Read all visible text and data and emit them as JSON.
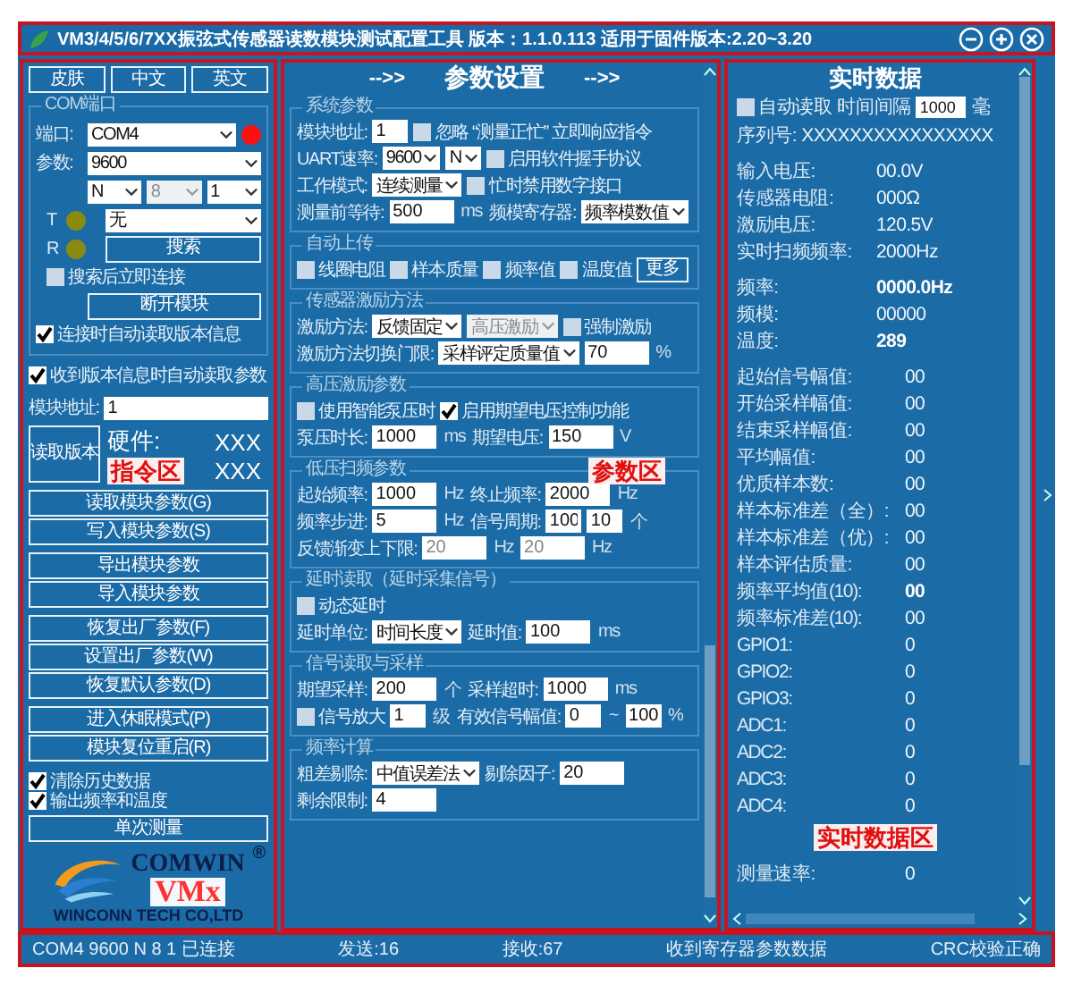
{
  "window": {
    "title": "VM3/4/5/6/7XX振弦式传感器读数模块测试配置工具   版本：1.1.0.113 适用于固件版本:2.20~3.20"
  },
  "left_panel": {
    "annotation": "指令区",
    "top_buttons": [
      "皮肤",
      "中文",
      "英文"
    ],
    "com_group": {
      "title": "COM端口",
      "port_label": "端口:",
      "port": "COM4",
      "port_lamp": {
        "on": true
      },
      "params_label": "参数:",
      "baud": "9600",
      "parity": "N",
      "data_bits": {
        "value": "8",
        "disabled": true
      },
      "stop_bits": "1",
      "flow": "无",
      "lamps": [
        {
          "label": "T",
          "on": false
        },
        {
          "label": "R",
          "on": false
        }
      ],
      "search_button": "搜索",
      "connect_after_search": {
        "label": "搜索后立即连接",
        "checked": false
      },
      "disconnect_button": "断开模块",
      "auto_read_version": {
        "label": "连接时自动读取版本信息",
        "checked": true
      }
    },
    "auto_read_params": {
      "label": "收到版本信息时自动读取参数",
      "checked": true
    },
    "address_label": "模块地址:",
    "address": "1",
    "read_version_button": "读取版本",
    "version_rows": [
      {
        "label": "硬件:",
        "value": "XXX"
      },
      {
        "value": "XXX"
      }
    ],
    "button_groups": [
      [
        "读取模块参数(G)",
        "写入模块参数(S)"
      ],
      [
        "导出模块参数",
        "导入模块参数"
      ],
      [
        "恢复出厂参数(F)",
        "设置出厂参数(W)",
        "恢复默认参数(D)"
      ],
      [
        "进入休眠模式(P)",
        "模块复位重启(R)"
      ]
    ],
    "bottom_checks": [
      {
        "label": "清除历史数据",
        "checked": true
      },
      {
        "label": "输出频率和温度",
        "checked": true
      }
    ],
    "single_measure_button": "单次测量",
    "logo": {
      "brand": "COMWIN",
      "reg": "®",
      "product": "VMx",
      "company": "WINCONN TECH CO,LTD"
    }
  },
  "middle_panel": {
    "annotation": "参数区",
    "header": {
      "left": "-->>",
      "title": "参数设置",
      "right": "-->>"
    },
    "groups": [
      {
        "title": "系统参数",
        "rows": [
          {
            "items": [
              {
                "kind": "label",
                "text": "模块地址:"
              },
              {
                "kind": "short_input",
                "value": "1"
              },
              {
                "kind": "checkbox",
                "text": "忽略 “测量正忙” 立即响应指令",
                "checked": false
              }
            ]
          },
          {
            "items": [
              {
                "kind": "label",
                "text": "UART速率:"
              },
              {
                "kind": "select",
                "value": "9600"
              },
              {
                "kind": "select",
                "value": "N"
              },
              {
                "kind": "checkbox",
                "text": "启用软件握手协议",
                "checked": false
              }
            ]
          },
          {
            "items": [
              {
                "kind": "label",
                "text": "工作模式:"
              },
              {
                "kind": "select",
                "value": "连续测量"
              },
              {
                "kind": "checkbox",
                "text": "忙时禁用数字接口",
                "checked": false
              }
            ]
          },
          {
            "items": [
              {
                "kind": "label",
                "text": "测量前等待:"
              },
              {
                "kind": "input",
                "value": "500"
              },
              {
                "kind": "unit",
                "text": "ms"
              },
              {
                "kind": "label",
                "text": "频模寄存器:"
              },
              {
                "kind": "select",
                "value": "频率模数值"
              }
            ]
          }
        ]
      },
      {
        "title": "自动上传",
        "rows": [
          {
            "items": [
              {
                "kind": "checkbox",
                "text": "线圈电阻",
                "checked": false
              },
              {
                "kind": "checkbox",
                "text": "样本质量",
                "checked": false
              },
              {
                "kind": "checkbox",
                "text": "频率值",
                "checked": false
              },
              {
                "kind": "checkbox",
                "text": "温度值",
                "checked": false
              },
              {
                "kind": "button",
                "text": "更多"
              }
            ]
          }
        ]
      },
      {
        "title": "传感器激励方法",
        "rows": [
          {
            "items": [
              {
                "kind": "label",
                "text": "激励方法:"
              },
              {
                "kind": "select",
                "value": "反馈固定"
              },
              {
                "kind": "select",
                "value": "高压激励",
                "disabled": true
              },
              {
                "kind": "checkbox",
                "text": "强制激励",
                "checked": false
              }
            ]
          },
          {
            "items": [
              {
                "kind": "label",
                "text": "激励方法切换门限:"
              },
              {
                "kind": "select",
                "value": "采样评定质量值"
              },
              {
                "kind": "input",
                "value": "70"
              },
              {
                "kind": "unit",
                "text": "%"
              }
            ]
          }
        ]
      },
      {
        "title": "高压激励参数",
        "rows": [
          {
            "items": [
              {
                "kind": "checkbox",
                "text": "使用智能泵压时",
                "checked": false
              },
              {
                "kind": "checkbox",
                "text": "启用期望电压控制功能",
                "checked": true
              }
            ]
          },
          {
            "items": [
              {
                "kind": "label",
                "text": "泵压时长:"
              },
              {
                "kind": "input",
                "value": "1000"
              },
              {
                "kind": "unit",
                "text": "ms"
              },
              {
                "kind": "label",
                "text": "期望电压:"
              },
              {
                "kind": "input",
                "value": "150"
              },
              {
                "kind": "unit",
                "text": "V"
              }
            ]
          }
        ]
      },
      {
        "title": "低压扫频参数",
        "rows": [
          {
            "items": [
              {
                "kind": "label",
                "text": "起始频率:"
              },
              {
                "kind": "input",
                "value": "1000"
              },
              {
                "kind": "unit",
                "text": "Hz"
              },
              {
                "kind": "label",
                "text": "终止频率:"
              },
              {
                "kind": "input",
                "value": "2000"
              },
              {
                "kind": "unit",
                "text": "Hz"
              }
            ]
          },
          {
            "items": [
              {
                "kind": "label",
                "text": "频率步进:"
              },
              {
                "kind": "input",
                "value": "5"
              },
              {
                "kind": "unit",
                "text": "Hz"
              },
              {
                "kind": "label",
                "text": "信号周期:"
              },
              {
                "kind": "short_input",
                "value": "100"
              },
              {
                "kind": "short_input",
                "value": "10"
              },
              {
                "kind": "unit",
                "text": "个"
              }
            ]
          },
          {
            "items": [
              {
                "kind": "label",
                "text": "反馈渐变上下限:"
              },
              {
                "kind": "input",
                "value": "20",
                "disabled": true
              },
              {
                "kind": "unit",
                "text": "Hz"
              },
              {
                "kind": "input",
                "value": "20",
                "disabled": true
              },
              {
                "kind": "unit",
                "text": "Hz"
              }
            ]
          }
        ]
      },
      {
        "title": "延时读取（延时采集信号）",
        "rows": [
          {
            "items": [
              {
                "kind": "checkbox",
                "text": "动态延时",
                "checked": false
              }
            ]
          },
          {
            "items": [
              {
                "kind": "label",
                "text": "延时单位:"
              },
              {
                "kind": "select",
                "value": "时间长度"
              },
              {
                "kind": "label",
                "text": "延时值:"
              },
              {
                "kind": "input",
                "value": "100"
              },
              {
                "kind": "unit",
                "text": "ms"
              }
            ]
          }
        ]
      },
      {
        "title": "信号读取与采样",
        "rows": [
          {
            "items": [
              {
                "kind": "label",
                "text": "期望采样:"
              },
              {
                "kind": "input",
                "value": "200"
              },
              {
                "kind": "unit",
                "text": "个"
              },
              {
                "kind": "label",
                "text": "采样超时:"
              },
              {
                "kind": "input",
                "value": "1000"
              },
              {
                "kind": "unit",
                "text": "ms"
              }
            ]
          },
          {
            "items": [
              {
                "kind": "checkbox",
                "text": "信号放大",
                "checked": false
              },
              {
                "kind": "short_input",
                "value": "1"
              },
              {
                "kind": "unit",
                "text": "级"
              },
              {
                "kind": "label",
                "text": "有效信号幅值:"
              },
              {
                "kind": "short_input",
                "value": "0"
              },
              {
                "kind": "unit",
                "text": "~"
              },
              {
                "kind": "short_input",
                "value": "100"
              },
              {
                "kind": "unit",
                "text": "%"
              }
            ]
          }
        ]
      },
      {
        "title": "频率计算",
        "rows": [
          {
            "items": [
              {
                "kind": "label",
                "text": "粗差剔除:"
              },
              {
                "kind": "select",
                "value": "中值误差法"
              },
              {
                "kind": "label",
                "text": "剔除因子:"
              },
              {
                "kind": "input",
                "value": "20"
              }
            ]
          },
          {
            "items": [
              {
                "kind": "label",
                "text": "剩余限制:"
              },
              {
                "kind": "input",
                "value": "4"
              }
            ]
          }
        ]
      }
    ]
  },
  "right_panel": {
    "annotation": "实时数据区",
    "title": "实时数据",
    "auto_read": {
      "label": "自动读取",
      "checked": false
    },
    "interval_label": "时间间隔",
    "interval": "1000",
    "interval_unit": "毫",
    "serial_label": "序列号:",
    "serial": "XXXXXXXXXXXXXXXX",
    "sections": [
      [
        {
          "label": "输入电压:",
          "value": "00.0V",
          "bold": false
        },
        {
          "label": "传感器电阻:",
          "value": "000Ω",
          "bold": false
        },
        {
          "label": "激励电压:",
          "value": "120.5V",
          "bold": false
        },
        {
          "label": "实时扫频频率:",
          "value": "2000Hz",
          "bold": false
        }
      ],
      [
        {
          "label": "频率:",
          "value": "0000.0Hz",
          "bold": true
        },
        {
          "label": "频模:",
          "value": "00000",
          "bold": false
        },
        {
          "label": "温度:",
          "value": "289",
          "bold": true
        }
      ],
      [
        {
          "label": "起始信号幅值:",
          "value": "00",
          "bold": false
        },
        {
          "label": "开始采样幅值:",
          "value": "00",
          "bold": false
        },
        {
          "label": "结束采样幅值:",
          "value": "00",
          "bold": false
        },
        {
          "label": "平均幅值:",
          "value": "00",
          "bold": false
        },
        {
          "label": "优质样本数:",
          "value": "00",
          "bold": false
        },
        {
          "label": "样本标准差（全）:",
          "value": "00",
          "bold": false
        },
        {
          "label": "样本标准差（优）:",
          "value": "00",
          "bold": false
        },
        {
          "label": "样本评估质量:",
          "value": "00",
          "bold": false
        },
        {
          "label": "频率平均值(10):",
          "value": "00",
          "bold": true
        },
        {
          "label": "频率标准差(10):",
          "value": "00",
          "bold": false
        },
        {
          "label": "GPIO1:",
          "value": "0",
          "bold": false
        },
        {
          "label": "GPIO2:",
          "value": "0",
          "bold": false
        },
        {
          "label": "GPIO3:",
          "value": "0",
          "bold": false
        },
        {
          "label": "ADC1:",
          "value": "0",
          "bold": false
        },
        {
          "label": "ADC2:",
          "value": "0",
          "bold": false
        },
        {
          "label": "ADC3:",
          "value": "0",
          "bold": false
        },
        {
          "label": "ADC4:",
          "value": "0",
          "bold": false
        }
      ],
      [
        {
          "label": "测量速率:",
          "value": "0",
          "bold": false
        }
      ]
    ]
  },
  "status_bar": [
    "COM4 9600 N 8 1 已连接",
    "发送:16",
    "接收:67",
    "收到寄存器参数数据",
    "CRC校验正确"
  ]
}
